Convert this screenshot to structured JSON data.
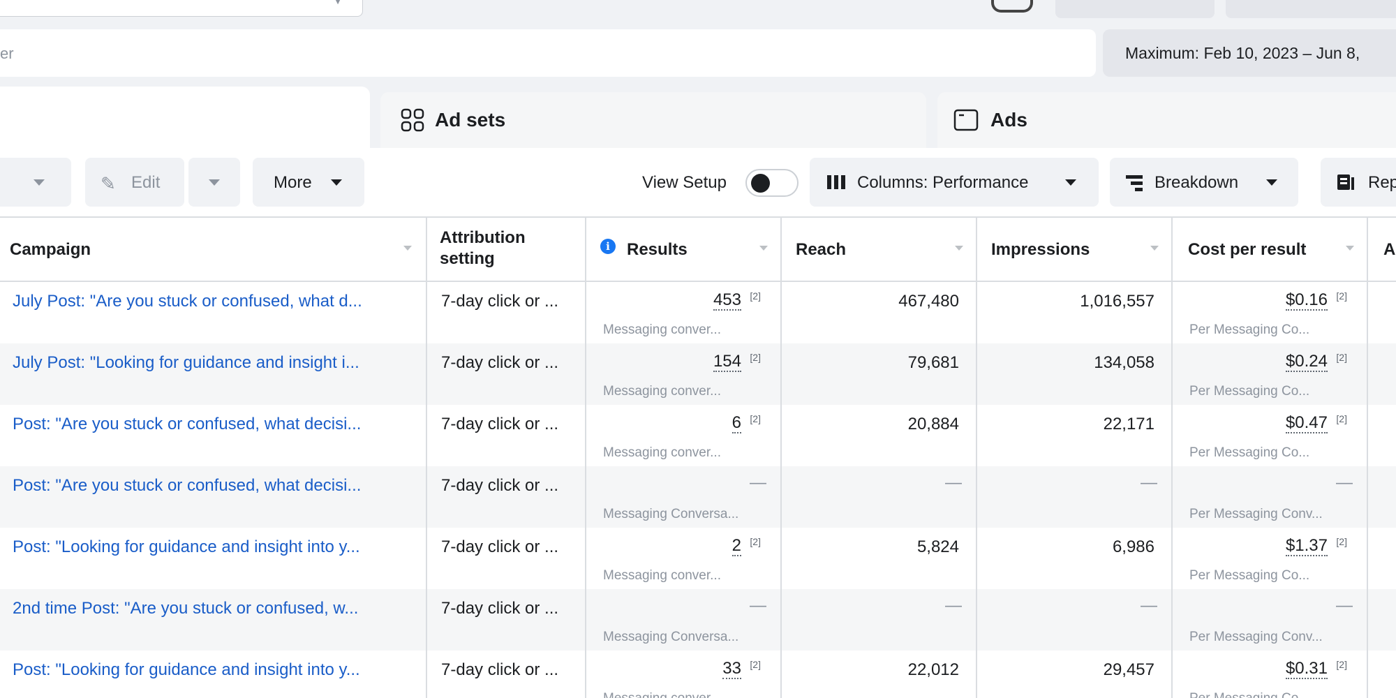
{
  "top": {
    "search_placeholder": "er",
    "date_range": "Maximum: Feb 10, 2023 – Jun 8,"
  },
  "tabs": [
    {
      "label": "",
      "icon": "campaigns-icon"
    },
    {
      "label": "Ad sets",
      "icon": "ad-sets-grid-icon"
    },
    {
      "label": "Ads",
      "icon": "ads-window-icon"
    }
  ],
  "toolbar": {
    "edit_label": "Edit",
    "more_label": "More",
    "view_setup_label": "View Setup",
    "view_setup_on": false,
    "columns_label": "Columns: Performance",
    "breakdown_label": "Breakdown",
    "reports_label": "Rep"
  },
  "table": {
    "headers": {
      "campaign": "Campaign",
      "attribution": "Attribution setting",
      "results": "Results",
      "reach": "Reach",
      "impressions": "Impressions",
      "cost_per_result": "Cost per result",
      "next": "A"
    },
    "rows": [
      {
        "campaign": "July Post: \"Are you stuck or confused, what d...",
        "attribution": "7-day click or ...",
        "results": "453",
        "results_note": "[2]",
        "results_sub": "Messaging conver...",
        "reach": "467,480",
        "impressions": "1,016,557",
        "cost": "$0.16",
        "cost_note": "[2]",
        "cost_sub": "Per Messaging Co..."
      },
      {
        "campaign": "July Post: \"Looking for guidance and insight i...",
        "attribution": "7-day click or ...",
        "results": "154",
        "results_note": "[2]",
        "results_sub": "Messaging conver...",
        "reach": "79,681",
        "impressions": "134,058",
        "cost": "$0.24",
        "cost_note": "[2]",
        "cost_sub": "Per Messaging Co..."
      },
      {
        "campaign": "Post: \"Are you stuck or confused, what decisi...",
        "attribution": "7-day click or ...",
        "results": "6",
        "results_note": "[2]",
        "results_sub": "Messaging conver...",
        "reach": "20,884",
        "impressions": "22,171",
        "cost": "$0.47",
        "cost_note": "[2]",
        "cost_sub": "Per Messaging Co..."
      },
      {
        "campaign": "Post: \"Are you stuck or confused, what decisi...",
        "attribution": "7-day click or ...",
        "results": "—",
        "results_note": "",
        "results_sub": "Messaging Conversa...",
        "reach": "—",
        "impressions": "—",
        "cost": "—",
        "cost_note": "",
        "cost_sub": "Per Messaging Conv..."
      },
      {
        "campaign": "Post: \"Looking for guidance and insight into y...",
        "attribution": "7-day click or ...",
        "results": "2",
        "results_note": "[2]",
        "results_sub": "Messaging conver...",
        "reach": "5,824",
        "impressions": "6,986",
        "cost": "$1.37",
        "cost_note": "[2]",
        "cost_sub": "Per Messaging Co..."
      },
      {
        "campaign": "2nd time Post: \"Are you stuck or confused, w...",
        "attribution": "7-day click or ...",
        "results": "—",
        "results_note": "",
        "results_sub": "Messaging Conversa...",
        "reach": "—",
        "impressions": "—",
        "cost": "—",
        "cost_note": "",
        "cost_sub": "Per Messaging Conv..."
      },
      {
        "campaign": "Post: \"Looking for guidance and insight into y...",
        "attribution": "7-day click or ...",
        "results": "33",
        "results_note": "[2]",
        "results_sub": "Messaging conver...",
        "reach": "22,012",
        "impressions": "29,457",
        "cost": "$0.31",
        "cost_note": "[2]",
        "cost_sub": "Per Messaging Co..."
      }
    ]
  },
  "colors": {
    "link": "#1a5dc8",
    "info": "#1877f2",
    "border": "#dadde1"
  }
}
